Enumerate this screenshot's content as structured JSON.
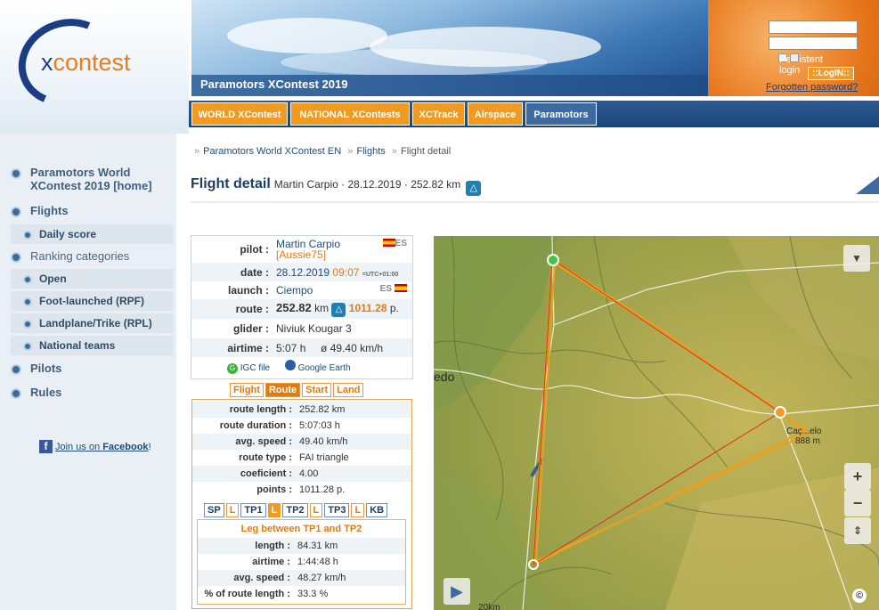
{
  "logo": {
    "brand_x": "x",
    "brand_rest": "contest"
  },
  "banner": {
    "title": "Paramotors XContest 2019"
  },
  "login": {
    "persistent_label": "Persistent login",
    "login_button": "::LogIN::",
    "forgot_link": "Forgotten password?"
  },
  "nav": {
    "tabs": [
      "WORLD XContest",
      "NATIONAL XContests",
      "XCTrack",
      "Airspace",
      "Paramotors"
    ]
  },
  "sidebar": {
    "home": "Paramotors World XContest 2019 [home]",
    "flights": "Flights",
    "daily_score": "Daily score",
    "ranking": "Ranking categories",
    "open": "Open",
    "foot": "Foot-launched (RPF)",
    "landplane": "Landplane/Trike (RPL)",
    "national": "National teams",
    "pilots": "Pilots",
    "rules": "Rules",
    "facebook_join": "Join us on ",
    "facebook_name": "Facebook",
    "facebook_bang": "!"
  },
  "breadcrumb": {
    "root": "Paramotors World XContest EN",
    "flights": "Flights",
    "current": "Flight detail"
  },
  "heading": {
    "title": "Flight detail",
    "subtitle": "Martin Carpio · 28.12.2019 · 252.82 km"
  },
  "info": {
    "pilot_label": "pilot :",
    "pilot_name": "Martin Carpio",
    "pilot_nick": "[Aussie75]",
    "pilot_country": "ES",
    "date_label": "date :",
    "date": "28.12.2019",
    "time": "09:07",
    "utc": "=UTC+01:00",
    "launch_label": "launch :",
    "launch": "Ciempo",
    "launch_country": "ES",
    "route_label": "route :",
    "route_km": "252.82",
    "route_km_unit": "km",
    "route_points": "1011.28",
    "route_points_unit": "p.",
    "glider_label": "glider :",
    "glider": "Niviuk Kougar 3",
    "airtime_label": "airtime :",
    "airtime": "5:07 h",
    "speed": "ø 49.40 km/h",
    "igc": "IGC file",
    "google_earth": "Google Earth"
  },
  "subtabs": [
    "Flight",
    "Route",
    "Start",
    "Land"
  ],
  "route": {
    "rows": [
      {
        "k": "route length :",
        "v": "252.82 km"
      },
      {
        "k": "route duration :",
        "v": "5:07:03 h"
      },
      {
        "k": "avg. speed :",
        "v": "49.40 km/h"
      },
      {
        "k": "route type :",
        "v": "FAI triangle"
      },
      {
        "k": "coeficient :",
        "v": "4.00"
      },
      {
        "k": "points :",
        "v": "1011.28 p."
      }
    ]
  },
  "legs": [
    "SP",
    "L",
    "TP1",
    "L",
    "TP2",
    "L",
    "TP3",
    "L",
    "KB"
  ],
  "leg": {
    "title": "Leg between TP1 and TP2",
    "rows": [
      {
        "k": "length :",
        "v": "84.31 km"
      },
      {
        "k": "airtime :",
        "v": "1:44:48 h"
      },
      {
        "k": "avg. speed :",
        "v": "48.27 km/h"
      },
      {
        "k": "% of route length :",
        "v": "33.3 %"
      }
    ]
  },
  "map": {
    "place_left": "edo",
    "place_right": "Caç...elo",
    "elevation": "888 m",
    "scale": "20km",
    "zoom_in": "+",
    "zoom_out": "−"
  }
}
